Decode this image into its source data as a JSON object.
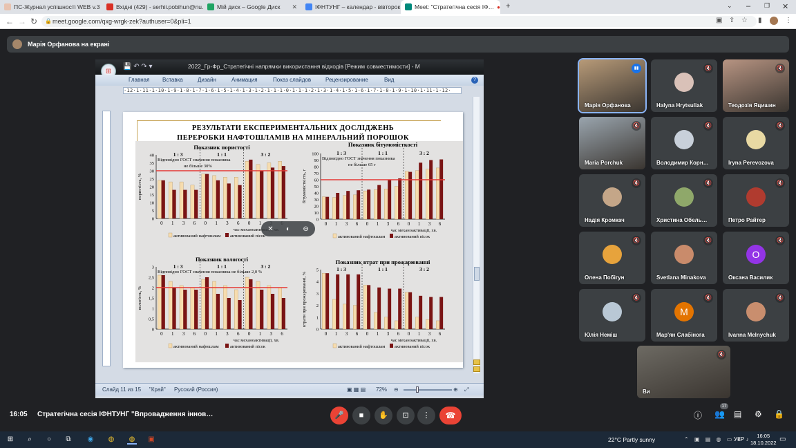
{
  "browser": {
    "tabs": [
      {
        "title": "ПС-Журнал успішності WEB v.3",
        "color": "#e8c3b0",
        "active": false
      },
      {
        "title": "Вхідні (429) - serhii.pobihun@nu…",
        "color": "#d93025",
        "active": false
      },
      {
        "title": "Мій диск – Google Диск",
        "color": "#1fa463",
        "active": false
      },
      {
        "title": "ІФНТУНГ – календар - вівторок",
        "color": "#4285f4",
        "active": false
      },
      {
        "title": "Meet: \"Стратегічна сесія ІФ…",
        "color": "#00897b",
        "active": true
      }
    ],
    "new_tab": "+",
    "url": "meet.google.com/qxg-wrgk-zek?authuser=0&pli=1"
  },
  "presenting": {
    "label": "Марія Орфанова на екрані"
  },
  "powerpoint": {
    "doc_title": "2022_Гр-Фр_Стратегічні напрямки використання відходів  [Режим совместимости] - M",
    "ribbon_tabs": [
      "Главная",
      "Вставка",
      "Дизайн",
      "Анимация",
      "Показ слайдов",
      "Рецензирование",
      "Вид"
    ],
    "ruler": "·12·1·11·1·10·1·9·1·8·1·7·1·6·1·5·1·4·1·3·1·2·1·1·1·0·1·1·1·2·1·3·1·4·1·5·1·6·1·7·1·8·1·9·1·10·1·11·1·12·",
    "status": {
      "slide": "Слайд 11 из 15",
      "theme": "\"Край\"",
      "lang": "Русский (Россия)",
      "zoom": "72%"
    },
    "slide": {
      "title_line1": "РЕЗУЛЬТАТИ ЕКСПЕРИМЕНТАЛЬНИХ ДОСЛІДЖЕНЬ",
      "title_line2": "ПЕРЕРОБКИ НАФТОШЛАМІВ НА МІНЕРАЛЬНИЙ ПОРОШОК"
    }
  },
  "chart_data": [
    {
      "type": "bar",
      "title": "Показник пористості",
      "ylabel": "пористість, %",
      "xlabel": "час механоактивації, хв.",
      "ylim": [
        0,
        40
      ],
      "yticks": [
        "0",
        "5",
        "10",
        "15",
        "20",
        "25",
        "30",
        "35",
        "40"
      ],
      "categories": [
        "0",
        "1",
        "3",
        "6",
        "0",
        "1",
        "3",
        "6",
        "0",
        "1",
        "3",
        "6"
      ],
      "groups": [
        "1 : 3",
        "1 : 1",
        "3 : 2"
      ],
      "threshold": 30,
      "annotation": "Відповідно ГОСТ значення показника не більше 30%",
      "series": [
        {
          "name": "активований нафтошлам",
          "values": [
            24,
            23,
            23,
            21,
            28,
            27,
            26,
            26,
            36,
            34,
            35,
            36
          ]
        },
        {
          "name": "активований пісок",
          "values": [
            24,
            18,
            18,
            18,
            28,
            24,
            22,
            21,
            37,
            30,
            32,
            33
          ]
        }
      ]
    },
    {
      "type": "bar",
      "title": "Показник бітумомісткості",
      "ylabel": "бітумомісткість, г",
      "xlabel": "час механоактивації, хв.",
      "ylim": [
        0,
        100
      ],
      "yticks": [
        "0",
        "10",
        "20",
        "30",
        "40",
        "50",
        "60",
        "70",
        "80",
        "90",
        "100"
      ],
      "categories": [
        "0",
        "1",
        "3",
        "6",
        "0",
        "1",
        "3",
        "6",
        "0",
        "1",
        "3",
        "6"
      ],
      "groups": [
        "1 : 3",
        "1 : 1",
        "3 : 2"
      ],
      "threshold": 60,
      "annotation": "Відповідно ГОСТ значення показника не більше 65 г",
      "series": [
        {
          "name": "активований нафтошлам",
          "values": [
            34,
            33,
            36,
            37,
            43,
            45,
            46,
            50,
            73,
            74,
            76,
            78
          ]
        },
        {
          "name": "активований пісок",
          "values": [
            34,
            40,
            43,
            44,
            45,
            52,
            60,
            62,
            72,
            86,
            90,
            91
          ]
        }
      ]
    },
    {
      "type": "bar",
      "title": "Показник вологості",
      "ylabel": "вологість, %",
      "xlabel": "час механоактивації, хв.",
      "ylim": [
        0,
        3
      ],
      "yticks": [
        "0",
        "0,5",
        "1",
        "1,5",
        "2",
        "2,5",
        "3"
      ],
      "categories": [
        "0",
        "1",
        "3",
        "6",
        "0",
        "1",
        "3",
        "6",
        "0",
        "1",
        "3",
        "6"
      ],
      "groups": [
        "1 : 3",
        "1 : 1",
        "3 : 2"
      ],
      "threshold": 2,
      "annotation": "Відповідно ГОСТ значення показника не більше 2,0 %",
      "series": [
        {
          "name": "активований нафошлам",
          "values": [
            2.6,
            2.3,
            2.1,
            2.0,
            2.4,
            2.3,
            2.1,
            1.9,
            2.5,
            2.3,
            2.1,
            2.0
          ]
        },
        {
          "name": "активований пісок",
          "values": [
            2.6,
            2.0,
            1.9,
            1.9,
            2.5,
            1.7,
            1.5,
            1.4,
            2.4,
            1.9,
            1.7,
            1.5
          ]
        }
      ]
    },
    {
      "type": "bar",
      "title": "Показник втрат при прожарюванні",
      "ylabel": "втрати при прожарюванні, %",
      "xlabel": "час механоактивації, хв.",
      "ylim": [
        0,
        5
      ],
      "yticks": [
        "0",
        "1",
        "2",
        "3",
        "4",
        "5"
      ],
      "categories": [
        "0",
        "1",
        "3",
        "6",
        "0",
        "1",
        "3",
        "6",
        "0",
        "1",
        "3",
        "6"
      ],
      "groups": [
        "1 : 3",
        "1 : 1",
        "3 : 2"
      ],
      "threshold": null,
      "annotation": "",
      "series": [
        {
          "name": "активований нафтошлам",
          "values": [
            4.7,
            2.5,
            2.1,
            2.0,
            3.7,
            1.4,
            1.0,
            0.7,
            3.1,
            1.0,
            0.8,
            0.7
          ]
        },
        {
          "name": "активований пісок",
          "values": [
            4.7,
            4.6,
            4.6,
            4.6,
            3.7,
            3.5,
            3.4,
            3.4,
            3.1,
            2.8,
            2.7,
            2.7
          ]
        }
      ]
    }
  ],
  "colors": {
    "nafto": "#f6dcae",
    "pisok": "#7a1414",
    "threshold": "#e53935"
  },
  "participants": [
    {
      "name": "Марія Орфанова",
      "kind": "photo",
      "color": "#b79a78",
      "speaking": true
    },
    {
      "name": "Halyna Hrytsuliak",
      "kind": "avatar",
      "color": "#d9c1b8",
      "initial": ""
    },
    {
      "name": "Теодозія Яцишин",
      "kind": "photo",
      "color": "#b79482"
    },
    {
      "name": "Maria Porchuk",
      "kind": "photo",
      "color": "#9aa5ae"
    },
    {
      "name": "Володимир Корн…",
      "kind": "avatar",
      "color": "#c8d0da",
      "initial": ""
    },
    {
      "name": "Iryna Perevozova",
      "kind": "avatar",
      "color": "#e8d9a3",
      "initial": ""
    },
    {
      "name": "Надія Кромкач",
      "kind": "avatar",
      "color": "#c4a688",
      "initial": ""
    },
    {
      "name": "Христина Обель…",
      "kind": "avatar",
      "color": "#8fa86a",
      "initial": ""
    },
    {
      "name": "Петро Райтер",
      "kind": "avatar",
      "color": "#b03b2f",
      "initial": ""
    },
    {
      "name": "Олена Побігун",
      "kind": "avatar",
      "color": "#e7a33c",
      "initial": ""
    },
    {
      "name": "Svetlana Minakova",
      "kind": "avatar",
      "color": "#c98b6b",
      "initial": ""
    },
    {
      "name": "Оксана Василик",
      "kind": "avatar",
      "color": "#9334e6",
      "initial": "О"
    },
    {
      "name": "Юлія Неміш",
      "kind": "avatar",
      "color": "#b9c8d5",
      "initial": ""
    },
    {
      "name": "Мар'ян Слабінога",
      "kind": "avatar",
      "color": "#e37400",
      "initial": "М"
    },
    {
      "name": "Ivanna Melnychuk",
      "kind": "avatar",
      "color": "#c98e6e",
      "initial": ""
    },
    {
      "name": "Ви",
      "kind": "photo",
      "color": "#6d6a63"
    }
  ],
  "meeting": {
    "time": "16:05",
    "title": "Стратегічна сесія ІФНТУНГ \"Впровадження іннов…",
    "participant_count": "17"
  },
  "taskbar": {
    "weather": "22°C  Partly sunny",
    "lang": "УКР",
    "time": "16:05",
    "date": "18.10.2022"
  }
}
